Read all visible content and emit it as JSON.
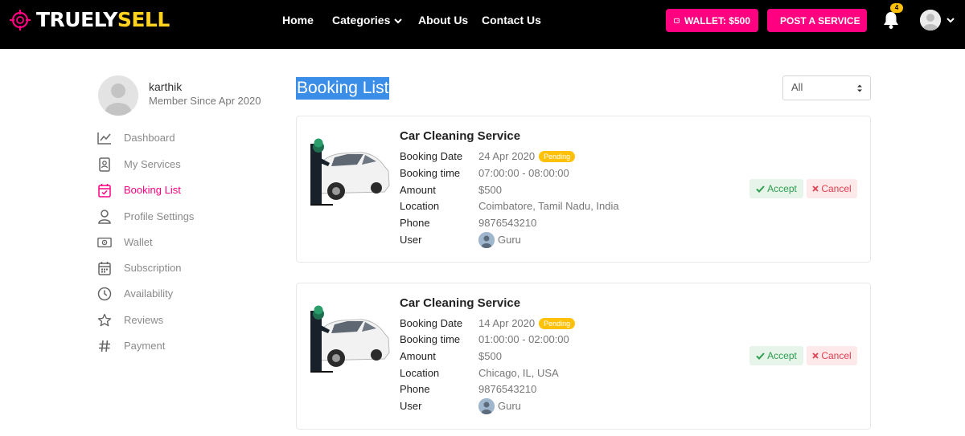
{
  "brand": {
    "part1": "TRUELY",
    "part2": "SELL"
  },
  "nav": {
    "home": "Home",
    "categories": "Categories",
    "about": "About Us",
    "contact": "Contact Us"
  },
  "header": {
    "wallet_label": "WALLET: $500",
    "post_label": "POST A SERVICE",
    "notification_count": "4"
  },
  "profile": {
    "name": "karthik",
    "member_since": "Member Since Apr 2020"
  },
  "sidebar": {
    "items": [
      {
        "label": "Dashboard",
        "icon": "chart-line-icon"
      },
      {
        "label": "My Services",
        "icon": "id-badge-icon"
      },
      {
        "label": "Booking List",
        "icon": "calendar-check-icon"
      },
      {
        "label": "Profile Settings",
        "icon": "user-icon"
      },
      {
        "label": "Wallet",
        "icon": "money-bill-icon"
      },
      {
        "label": "Subscription",
        "icon": "calendar-icon"
      },
      {
        "label": "Availability",
        "icon": "clock-icon"
      },
      {
        "label": "Reviews",
        "icon": "star-icon"
      },
      {
        "label": "Payment",
        "icon": "hashtag-icon"
      }
    ],
    "active_index": 2
  },
  "main": {
    "title": "Booking List",
    "filter": {
      "selected": "All"
    }
  },
  "labels": {
    "booking_date": "Booking Date",
    "booking_time": "Booking time",
    "amount": "Amount",
    "location": "Location",
    "phone": "Phone",
    "user": "User",
    "accept": "Accept",
    "cancel": "Cancel"
  },
  "bookings": [
    {
      "title": "Car Cleaning Service",
      "date": "24 Apr 2020",
      "status": "Pending",
      "time": "07:00:00 - 08:00:00",
      "amount": "$500",
      "location": "Coimbatore, Tamil Nadu, India",
      "phone": "9876543210",
      "user": "Guru"
    },
    {
      "title": "Car Cleaning Service",
      "date": "14 Apr 2020",
      "status": "Pending",
      "time": "01:00:00 - 02:00:00",
      "amount": "$500",
      "location": "Chicago, IL, USA",
      "phone": "9876543210",
      "user": "Guru"
    }
  ],
  "colors": {
    "brand_pink": "#ff0080",
    "brand_yellow": "#ffd21f",
    "pending": "#ffc107",
    "accept_text": "#2e9e50",
    "cancel_text": "#e0404f"
  }
}
